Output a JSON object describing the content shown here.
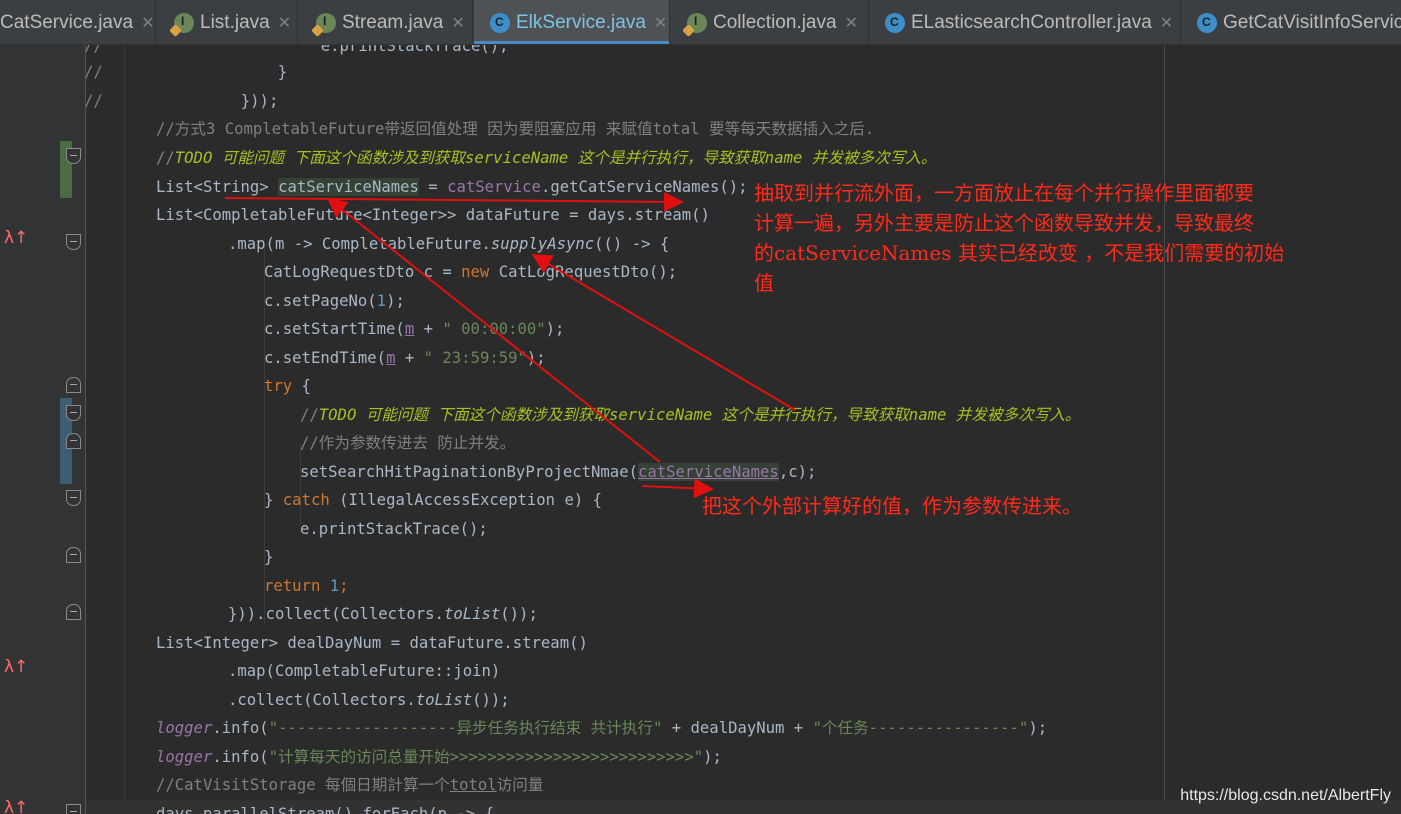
{
  "tabs": [
    {
      "label": "CatService.java",
      "icon": "class-icon",
      "active": false
    },
    {
      "label": "List.java",
      "icon": "interface-icon",
      "active": false
    },
    {
      "label": "Stream.java",
      "icon": "interface-icon",
      "active": false
    },
    {
      "label": "ElkService.java",
      "icon": "class-icon",
      "active": true
    },
    {
      "label": "Collection.java",
      "icon": "interface-icon",
      "active": false
    },
    {
      "label": "ELasticsearchController.java",
      "icon": "class-icon",
      "active": false
    },
    {
      "label": "GetCatVisitInfoServic",
      "icon": "class-icon",
      "active": false
    }
  ],
  "gutter": {
    "comment_marks": [
      "//",
      "//",
      "//"
    ],
    "override_icon": "λ↑"
  },
  "code": {
    "l1": "e.printStackTrace();",
    "l2": "}",
    "l3": "}));",
    "l4": "//方式3 CompletableFuture带返回值处理 因为要阻塞应用 来赋值total 要等每天数据插入之后.",
    "l5_prefix": "//",
    "l5_todo": "TODO 可能问题 下面这个函数涉及到获取serviceName 这个是并行执行，导致获取name 并发被多次写入。",
    "l6_a": "List<String> ",
    "l6_b": "catServiceNames",
    "l6_c": " = ",
    "l6_d": "catService",
    "l6_e": ".getCatServiceNames();",
    "l7": "List<CompletableFuture<Integer>> dataFuture = days.stream()",
    "l8_a": ".map(m -> CompletableFuture.",
    "l8_b": "supplyAsync",
    "l8_c": "(() -> {",
    "l9_a": "CatLogRequestDto c = ",
    "l9_b": "new",
    "l9_c": " CatLogRequestDto();",
    "l10_a": "c.setPageNo(",
    "l10_b": "1",
    "l10_c": ");",
    "l11_a": "c.setStartTime(",
    "l11_m": "m",
    "l11_b": " + ",
    "l11_s": "\" 00:00:00\"",
    "l11_c": ");",
    "l12_a": "c.setEndTime(",
    "l12_m": "m",
    "l12_b": " + ",
    "l12_s": "\" 23:59:59\"",
    "l12_c": ");",
    "l13_a": "try",
    "l13_b": " {",
    "l14_prefix": "//",
    "l14_todo": "TODO 可能问题 下面这个函数涉及到获取serviceName 这个是并行执行，导致获取name 并发被多次写入。",
    "l15": "//作为参数传进去 防止并发。",
    "l16_a": "setSearchHitPaginationByProjectNmae(",
    "l16_b": "catServiceNames",
    "l16_c": ",c);",
    "l17_a": "} ",
    "l17_b": "catch",
    "l17_c": " (IllegalAccessException e) {",
    "l18": "e.printStackTrace();",
    "l19": "}",
    "l20_a": "return",
    "l20_b": " ",
    "l20_c": "1",
    "l20_d": ";",
    "l21_a": "})).collect(Collectors.",
    "l21_b": "toList",
    "l21_c": "());",
    "l22": "List<Integer> dealDayNum = dataFuture.stream()",
    "l23": ".map(CompletableFuture::join)",
    "l24_a": ".collect(Collectors.",
    "l24_b": "toList",
    "l24_c": "());",
    "l25_a": "logger",
    "l25_b": ".info(",
    "l25_c": "\"-------------------异步任务执行结束 共计执行\"",
    "l25_d": " + dealDayNum + ",
    "l25_e": "\"个任务----------------\"",
    "l25_f": ");",
    "l26_a": "logger",
    "l26_b": ".info(",
    "l26_c": "\"计算每天的访问总量开始>>>>>>>>>>>>>>>>>>>>>>>>>>\"",
    "l26_d": ");",
    "l27_a": "//CatVisitStorage 每個日期計算一个",
    "l27_b": "totol",
    "l27_c": "访问量",
    "l28": "days.parallelStream().forEach(p -> {"
  },
  "annotations": {
    "main_note_line1": "抽取到并行流外面，一方面放止在每个并行操作里面都要",
    "main_note_line2": "计算一遍，另外主要是防止这个函数导致并发，导致最终",
    "main_note_line3": "的catServiceNames 其实已经改变 ，不是我们需要的初始",
    "main_note_line4": "值",
    "param_note": "把这个外部计算好的值，作为参数传进来。",
    "arrow_color": "#e01010"
  },
  "watermark": "https://blog.csdn.net/AlbertFly"
}
